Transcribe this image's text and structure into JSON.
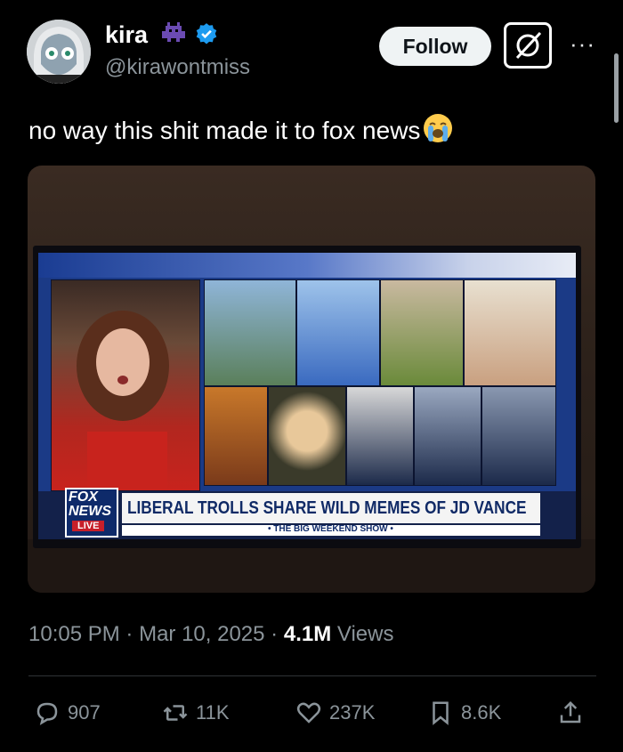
{
  "author": {
    "display_name": "kira",
    "handle": "@kirawontmiss",
    "badges": [
      "alien-monster-emoji",
      "verified-badge-icon"
    ],
    "verified_color": "#1d9bf0"
  },
  "actions_top": {
    "follow_label": "Follow",
    "grok_icon": "grok-icon",
    "more_icon": "more-icon"
  },
  "tweet": {
    "text": "no way this shit made it to fox news",
    "emoji": "loudly-crying-face-emoji"
  },
  "media": {
    "headline": "LIBERAL TROLLS SHARE WILD MEMES OF JD VANCE",
    "fox_logo_fox": "FOX",
    "fox_logo_news": "NEWS",
    "fox_logo_live": "LIVE",
    "show_name": "• THE BIG WEEKEND SHOW •"
  },
  "meta": {
    "time": "10:05 PM",
    "separator": "·",
    "date": "Mar 10, 2025",
    "views_count": "4.1M",
    "views_label": "Views"
  },
  "engagement": {
    "replies": "907",
    "reposts": "11K",
    "likes": "237K",
    "bookmarks": "8.6K"
  }
}
